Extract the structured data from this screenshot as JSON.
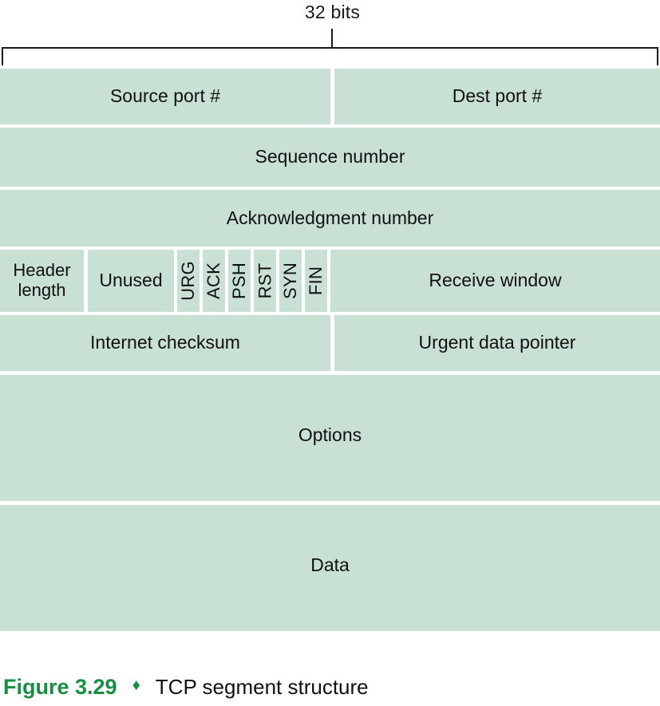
{
  "figure": {
    "width_annotation": {
      "label": "32 bits"
    },
    "caption": {
      "number": "Figure 3.29",
      "separator": "♦",
      "title": "TCP segment structure"
    },
    "colors": {
      "cell_fill": "#c9e0d5",
      "accent_green": "#168f44",
      "text": "#111111",
      "rule": "#1a1a1a",
      "background": "#ffffff"
    },
    "rows": [
      {
        "name": "ports",
        "cells": [
          {
            "label": "Source port #"
          },
          {
            "label": "Dest port #"
          }
        ]
      },
      {
        "name": "sequence",
        "cells": [
          {
            "label": "Sequence number"
          }
        ]
      },
      {
        "name": "acknowledgment",
        "cells": [
          {
            "label": "Acknowledgment number"
          }
        ]
      },
      {
        "name": "flags",
        "cells": [
          {
            "label": "Header length"
          },
          {
            "label": "Unused"
          },
          {
            "label": "URG"
          },
          {
            "label": "ACK"
          },
          {
            "label": "PSH"
          },
          {
            "label": "RST"
          },
          {
            "label": "SYN"
          },
          {
            "label": "FIN"
          },
          {
            "label": "Receive window"
          }
        ]
      },
      {
        "name": "checksum",
        "cells": [
          {
            "label": "Internet checksum"
          },
          {
            "label": "Urgent data pointer"
          }
        ]
      },
      {
        "name": "options",
        "cells": [
          {
            "label": "Options"
          }
        ]
      },
      {
        "name": "data",
        "cells": [
          {
            "label": "Data"
          }
        ]
      }
    ]
  }
}
